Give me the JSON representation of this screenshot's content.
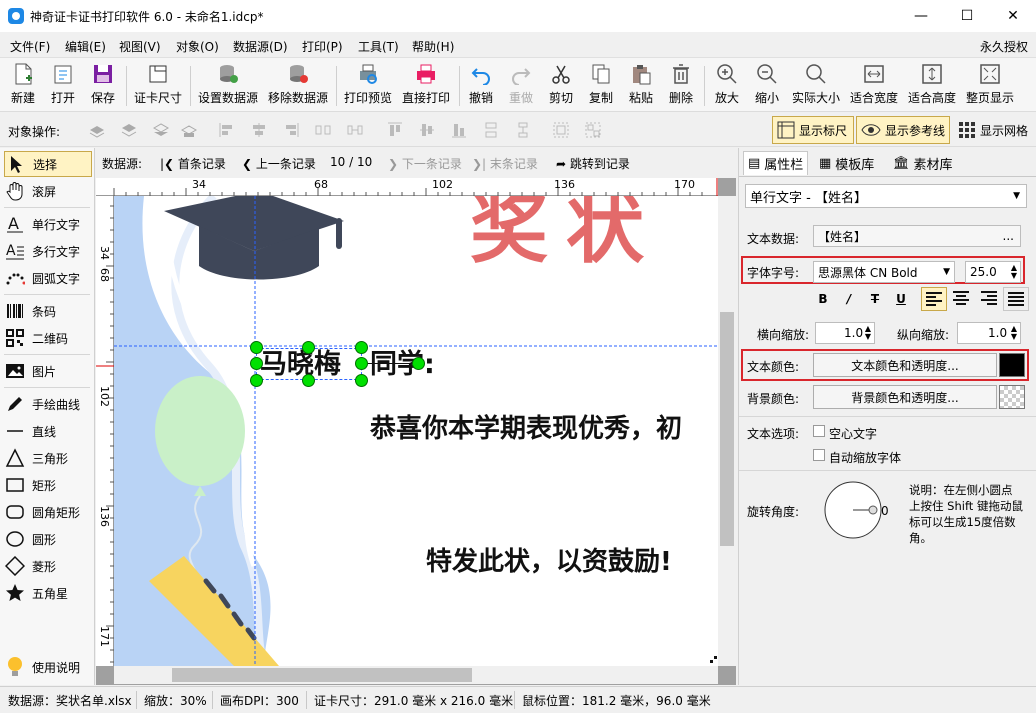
{
  "window": {
    "title": "神奇证卡证书打印软件 6.0 - 未命名1.idcp*",
    "minimize": "—",
    "maximize": "☐",
    "close": "✕"
  },
  "menu": {
    "items": [
      "文件(F)",
      "编辑(E)",
      "视图(V)",
      "对象(O)",
      "数据源(D)",
      "打印(P)",
      "工具(T)",
      "帮助(H)"
    ],
    "license": "永久授权"
  },
  "toolbar": {
    "items": [
      "新建",
      "打开",
      "保存",
      "证卡尺寸",
      "设置数据源",
      "移除数据源",
      "打印预览",
      "直接打印",
      "撤销",
      "重做",
      "剪切",
      "复制",
      "粘贴",
      "删除",
      "放大",
      "缩小",
      "实际大小",
      "适合宽度",
      "适合高度",
      "整页显示"
    ]
  },
  "objbar": {
    "label": "对象操作:",
    "show_ruler": "显示标尺",
    "show_guides": "显示参考线",
    "show_grid": "显示网格"
  },
  "left_tools": {
    "items": [
      "选择",
      "滚屏",
      "单行文字",
      "多行文字",
      "圆弧文字",
      "条码",
      "二维码",
      "图片",
      "手绘曲线",
      "直线",
      "三角形",
      "矩形",
      "圆角矩形",
      "圆形",
      "菱形",
      "五角星"
    ],
    "help": "使用说明"
  },
  "records": {
    "label": "数据源:",
    "first": "首条记录",
    "prev": "上一条记录",
    "counter": "10 / 10",
    "next": "下一条记录",
    "last": "末条记录",
    "jump": "跳转到记录"
  },
  "ruler": {
    "h_ticks": [
      "34",
      "68",
      "102",
      "136",
      "170"
    ],
    "v_ticks": [
      "34",
      "68",
      "102",
      "136",
      "171"
    ]
  },
  "card": {
    "title_partial": "奖状",
    "name": "马晓梅",
    "greeting_suffix": "同学:",
    "line1": "恭喜你本学期表现优秀，初",
    "line2": "特发此状，以资鼓励!"
  },
  "right_panel": {
    "tabs": [
      "属性栏",
      "模板库",
      "素材库"
    ],
    "object_select": "单行文字 - 【姓名】",
    "text_data_label": "文本数据:",
    "text_data_value": "【姓名】",
    "ellipsis": "...",
    "font_label": "字体字号:",
    "font_value": "思源黑体 CN Bold",
    "font_size": "25.0",
    "bold": "B",
    "italic": "/",
    "strike": "T",
    "underline": "U",
    "hscale_label": "横向缩放:",
    "hscale": "1.0",
    "vscale_label": "纵向缩放:",
    "vscale": "1.0",
    "text_color_label": "文本颜色:",
    "text_color_button": "文本颜色和透明度...",
    "bg_color_label": "背景颜色:",
    "bg_color_button": "背景颜色和透明度...",
    "text_options_label": "文本选项:",
    "hollow_text": "空心文字",
    "auto_scale": "自动缩放字体",
    "rotation_label": "旋转角度:",
    "rotation_value": "0",
    "rotation_note": "说明：在左侧小圆点上按住 Shift 键拖动鼠标可以生成15度倍数角。",
    "text_color_hex": "#000000"
  },
  "status": {
    "datasource": "数据源：奖状名单.xlsx",
    "zoom": "缩放：30%",
    "dpi": "画布DPI：300",
    "size": "证卡尺寸：291.0 毫米 x 216.0 毫米",
    "mouse": "鼠标位置：181.2 毫米，96.0 毫米"
  }
}
